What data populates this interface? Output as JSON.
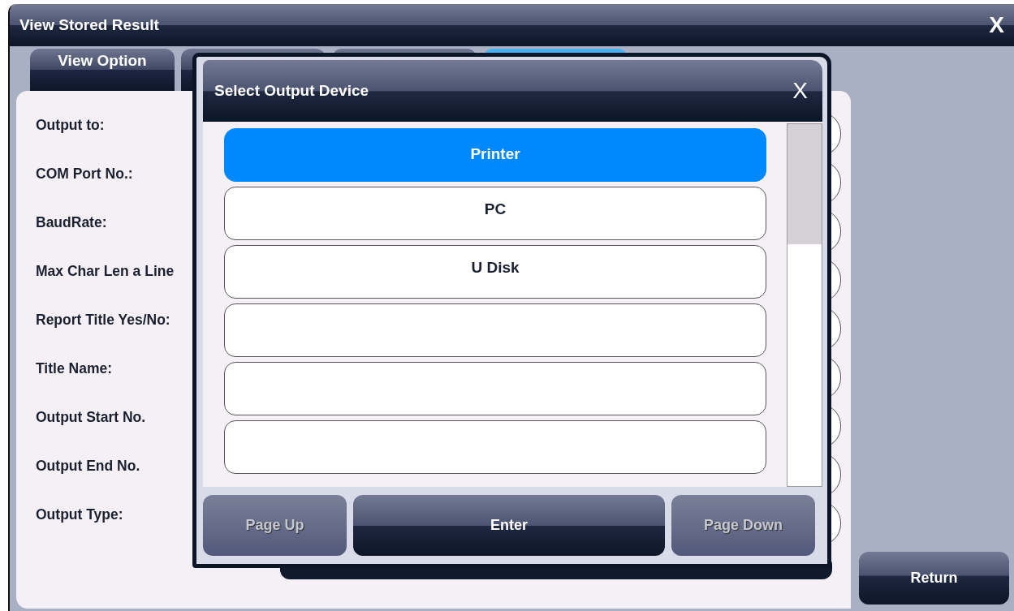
{
  "window": {
    "title": "View Stored Result",
    "close": "X"
  },
  "tabs": [
    {
      "label": "View Option",
      "selected": false
    },
    {
      "selected": false
    },
    {
      "selected": false
    },
    {
      "selected": true
    }
  ],
  "form": {
    "labels": [
      "Output to:",
      "COM Port No.:",
      "BaudRate:",
      "Max Char Len a Line",
      "Report Title Yes/No:",
      "Title Name:",
      "Output Start No.",
      "Output End No.",
      "Output Type:"
    ]
  },
  "return_button": "Return",
  "dialog": {
    "title": "Select Output Device",
    "close": "X",
    "options": [
      {
        "label": "Printer",
        "selected": true
      },
      {
        "label": "PC",
        "selected": false
      },
      {
        "label": "U Disk",
        "selected": false
      },
      {
        "selected": false
      },
      {
        "selected": false
      },
      {
        "selected": false
      }
    ],
    "buttons": [
      {
        "label": "Page Up",
        "disabled": true
      },
      {
        "label": "Enter",
        "disabled": false
      },
      {
        "label": "Page Down",
        "disabled": true
      }
    ]
  }
}
